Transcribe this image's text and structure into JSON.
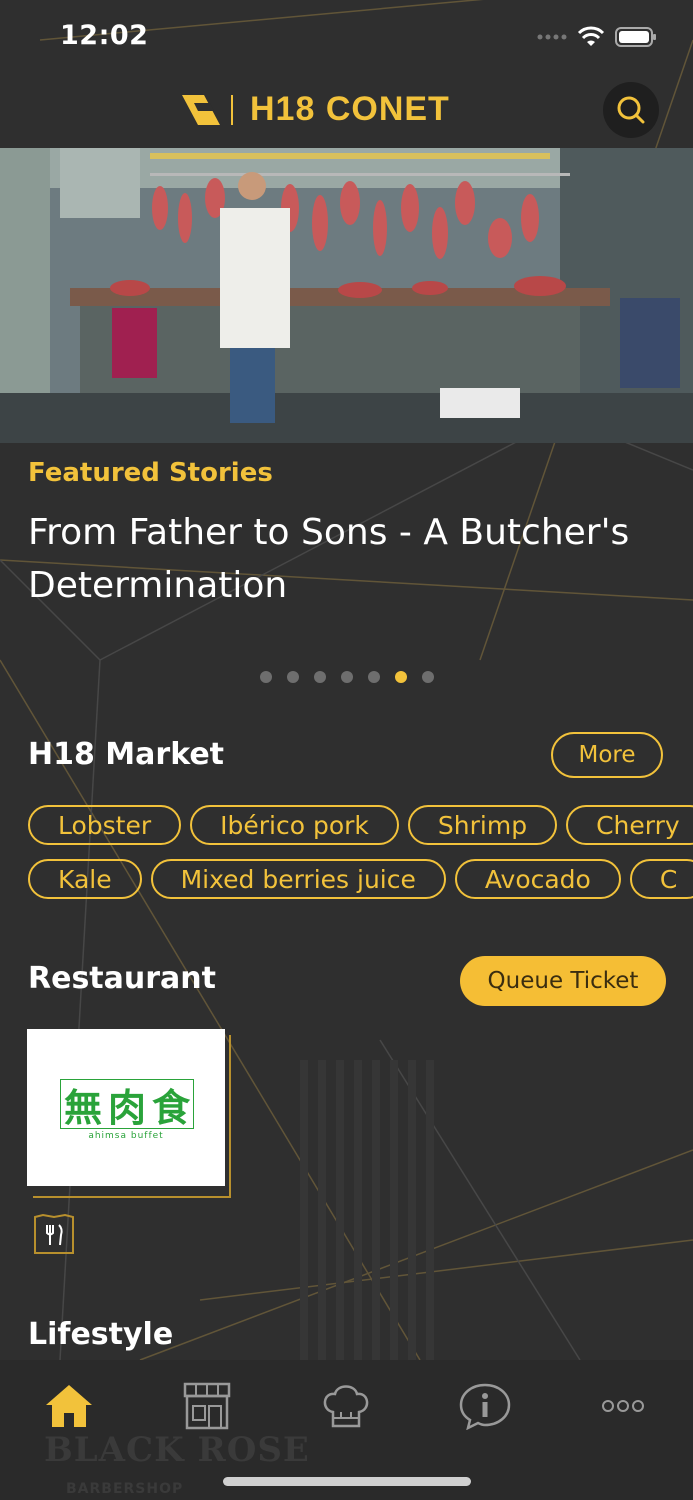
{
  "status_bar": {
    "time": "12:02"
  },
  "header": {
    "logo_text": "H18 CONET"
  },
  "hero": {
    "section_label": "Featured Stories",
    "story_title": "From Father to Sons - A Butcher's Determination",
    "slide_count": 7,
    "active_slide": 6
  },
  "market": {
    "title": "H18 Market",
    "more_label": "More",
    "row1": [
      "Lobster",
      "Ibérico pork",
      "Shrimp",
      "Cherry"
    ],
    "row2": [
      "Kale",
      "Mixed berries juice",
      "Avocado",
      "C"
    ]
  },
  "restaurant": {
    "title": "Restaurant",
    "queue_label": "Queue Ticket",
    "card": {
      "logo_chars": [
        "無",
        "肉",
        "食"
      ],
      "logo_sub": "ahimsa buffet"
    }
  },
  "lifestyle": {
    "title": "Lifestyle",
    "watermark": "BLACK ROSE",
    "watermark_sub": "BARBERSHOP"
  },
  "nav": {
    "items": [
      {
        "icon": "home-icon",
        "active": true
      },
      {
        "icon": "store-icon",
        "active": false
      },
      {
        "icon": "chef-hat-icon",
        "active": false
      },
      {
        "icon": "info-icon",
        "active": false
      },
      {
        "icon": "more-icon",
        "active": false
      }
    ]
  },
  "colors": {
    "accent": "#f2c23b",
    "background": "#2f2f2f",
    "nav_bg": "#2a2a2a",
    "restaurant_green": "#2aa33a"
  }
}
